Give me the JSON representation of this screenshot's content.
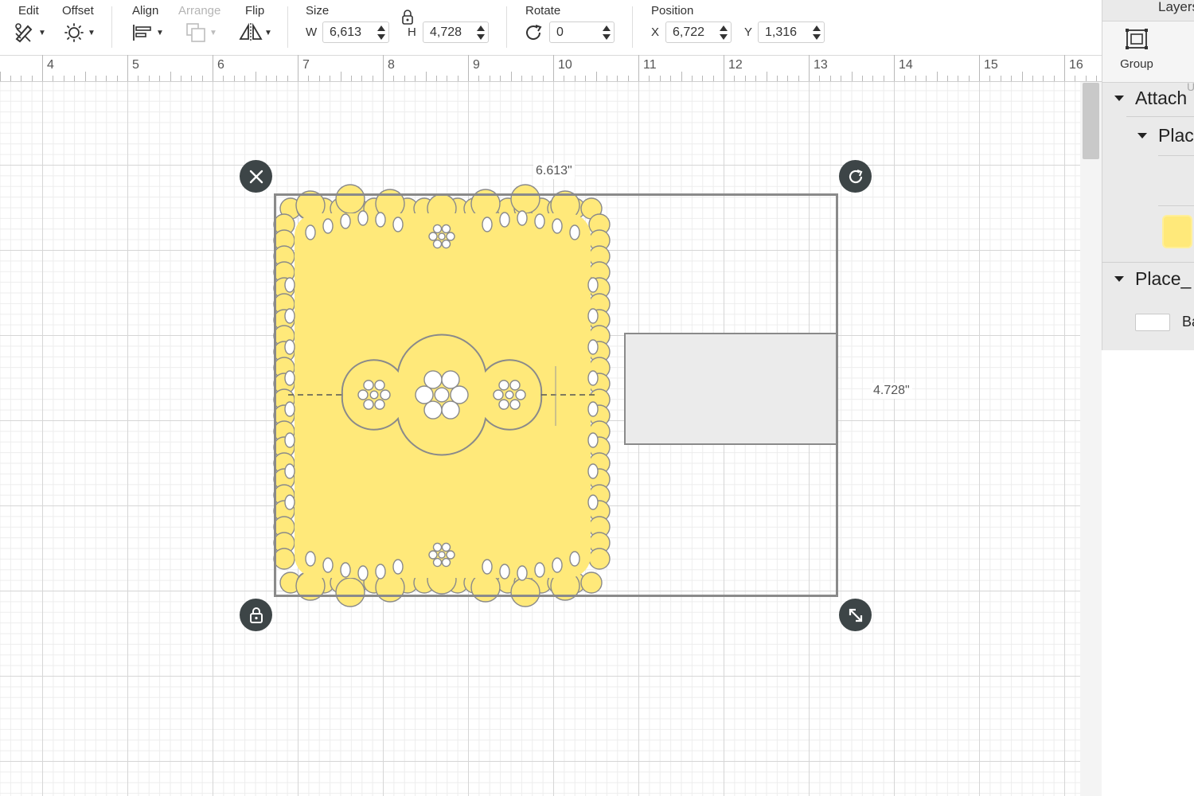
{
  "toolbar": {
    "edit": {
      "label": "Edit"
    },
    "offset": {
      "label": "Offset"
    },
    "align": {
      "label": "Align"
    },
    "arrange": {
      "label": "Arrange"
    },
    "flip": {
      "label": "Flip"
    },
    "size": {
      "label": "Size",
      "w_prefix": "W",
      "w_value": "6,613",
      "h_prefix": "H",
      "h_value": "4,728"
    },
    "rotate": {
      "label": "Rotate",
      "value": "0"
    },
    "position": {
      "label": "Position",
      "x_prefix": "X",
      "x_value": "6,722",
      "y_prefix": "Y",
      "y_value": "1,316"
    }
  },
  "ruler": {
    "numbers": [
      "4",
      "5",
      "6",
      "7",
      "8",
      "9",
      "10",
      "11",
      "12",
      "13",
      "14",
      "15",
      "16"
    ]
  },
  "canvas": {
    "width_label": "6.613\"",
    "height_label": "4.728\""
  },
  "layers_panel": {
    "title": "Layers",
    "group_label": "Group",
    "cut_letter": "U",
    "attach_label": "Attach",
    "place_label_1": "Place",
    "place_label_2": "Place_",
    "swatch_label": "Ba"
  },
  "colors": {
    "doily": "#ffe97a",
    "doily_stroke": "#8a8a8a",
    "handle": "#3d4547",
    "placeholder": "#ebebeb"
  },
  "icons": [
    "edit-icon",
    "offset-icon",
    "align-icon",
    "arrange-icon",
    "flip-icon",
    "lock-ratio-icon",
    "rotate-icon",
    "close-icon",
    "rotate-handle-icon",
    "lock-icon",
    "resize-icon",
    "group-icon"
  ]
}
